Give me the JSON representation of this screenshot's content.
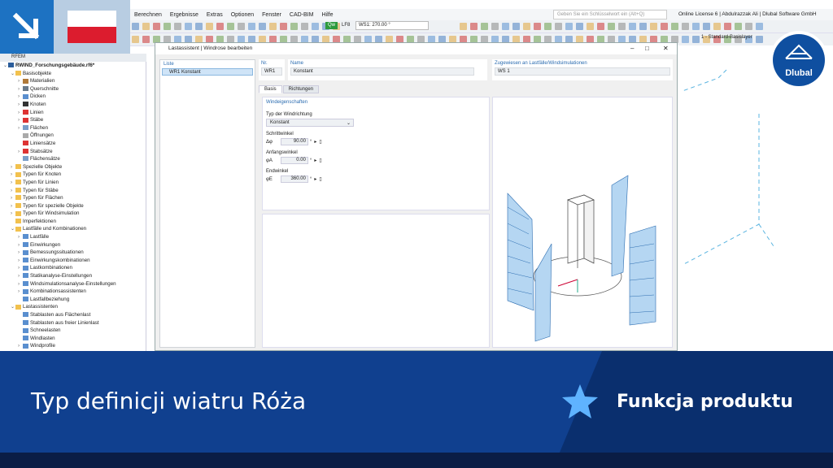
{
  "menu": [
    "Berechnen",
    "Ergebnisse",
    "Extras",
    "Optionen",
    "Fenster",
    "CAD-BIM",
    "Hilfe"
  ],
  "search_placeholder": "Geben Sie ein Schlüsselwort ein (Alt+Q)",
  "license": "Online License 6 | Abdulrazzak Ali | Dlubal Software GmbH",
  "toolbar": {
    "lf_badge": "Qw",
    "lf_num": "LF8",
    "ws": "WS1: 270.00 °",
    "layer": "1 - Standard-Basislayer"
  },
  "navigator": {
    "header": "RFEM",
    "items": [
      {
        "label": "RWIND_Forschungsgebäude.rf6*",
        "level": 0,
        "exp": "⌄",
        "icon": "#2b5d9b"
      },
      {
        "label": "Basisobjekte",
        "level": 1,
        "exp": "⌄",
        "icon": "#f2c14e"
      },
      {
        "label": "Materialien",
        "level": 2,
        "exp": "›",
        "icon": "#b07a3a"
      },
      {
        "label": "Querschnitte",
        "level": 2,
        "exp": "›",
        "icon": "#6a7b8c"
      },
      {
        "label": "Dicken",
        "level": 2,
        "exp": "›",
        "icon": "#5a8fcf"
      },
      {
        "label": "Knoten",
        "level": 2,
        "exp": "›",
        "icon": "#333"
      },
      {
        "label": "Linien",
        "level": 2,
        "exp": "›",
        "icon": "#d33"
      },
      {
        "label": "Stäbe",
        "level": 2,
        "exp": "›",
        "icon": "#d33"
      },
      {
        "label": "Flächen",
        "level": 2,
        "exp": "›",
        "icon": "#7a9ec8"
      },
      {
        "label": "Öffnungen",
        "level": 2,
        "exp": "",
        "icon": "#aaa"
      },
      {
        "label": "Liniensätze",
        "level": 2,
        "exp": "",
        "icon": "#d33"
      },
      {
        "label": "Stabsätze",
        "level": 2,
        "exp": "›",
        "icon": "#d33"
      },
      {
        "label": "Flächensätze",
        "level": 2,
        "exp": "",
        "icon": "#7a9ec8"
      },
      {
        "label": "Spezielle Objekte",
        "level": 1,
        "exp": "›",
        "icon": "#f2c14e"
      },
      {
        "label": "Typen für Knoten",
        "level": 1,
        "exp": "›",
        "icon": "#f2c14e"
      },
      {
        "label": "Typen für Linien",
        "level": 1,
        "exp": "›",
        "icon": "#f2c14e"
      },
      {
        "label": "Typen für Stäbe",
        "level": 1,
        "exp": "›",
        "icon": "#f2c14e"
      },
      {
        "label": "Typen für Flächen",
        "level": 1,
        "exp": "›",
        "icon": "#f2c14e"
      },
      {
        "label": "Typen für spezielle Objekte",
        "level": 1,
        "exp": "›",
        "icon": "#f2c14e"
      },
      {
        "label": "Typen für Windsimulation",
        "level": 1,
        "exp": "›",
        "icon": "#f2c14e"
      },
      {
        "label": "Imperfektionen",
        "level": 1,
        "exp": "",
        "icon": "#f2c14e"
      },
      {
        "label": "Lastfälle und Kombinationen",
        "level": 1,
        "exp": "⌄",
        "icon": "#f2c14e"
      },
      {
        "label": "Lastfälle",
        "level": 2,
        "exp": "›",
        "icon": "#5a8fcf"
      },
      {
        "label": "Einwirkungen",
        "level": 2,
        "exp": "›",
        "icon": "#5a8fcf"
      },
      {
        "label": "Bemessungssituationen",
        "level": 2,
        "exp": "›",
        "icon": "#5a8fcf"
      },
      {
        "label": "Einwirkungskombinationen",
        "level": 2,
        "exp": "›",
        "icon": "#5a8fcf"
      },
      {
        "label": "Lastkombinationen",
        "level": 2,
        "exp": "›",
        "icon": "#5a8fcf"
      },
      {
        "label": "Statikanalyse-Einstellungen",
        "level": 2,
        "exp": "›",
        "icon": "#5a8fcf"
      },
      {
        "label": "Windsimulationsanalyse-Einstellungen",
        "level": 2,
        "exp": "›",
        "icon": "#5a8fcf"
      },
      {
        "label": "Kombinationsassistenten",
        "level": 2,
        "exp": "›",
        "icon": "#5a8fcf"
      },
      {
        "label": "Lastfallbeziehung",
        "level": 2,
        "exp": "",
        "icon": "#5a8fcf"
      },
      {
        "label": "Lastassistenten",
        "level": 1,
        "exp": "⌄",
        "icon": "#f2c14e"
      },
      {
        "label": "Stablasten aus Flächenlast",
        "level": 2,
        "exp": "",
        "icon": "#5a8fcf"
      },
      {
        "label": "Stablasten aus freier Linienlast",
        "level": 2,
        "exp": "",
        "icon": "#5a8fcf"
      },
      {
        "label": "Schneelasten",
        "level": 2,
        "exp": "",
        "icon": "#5a8fcf"
      },
      {
        "label": "Windlasten",
        "level": 2,
        "exp": "",
        "icon": "#5a8fcf"
      },
      {
        "label": "Windprofile",
        "level": 2,
        "exp": "›",
        "icon": "#5a8fcf"
      }
    ]
  },
  "dialog": {
    "title": "Lastassistent | Windrose bearbeiten",
    "list_header": "Liste",
    "list_item": "WR1  Konstant",
    "nr_label": "Nr.",
    "nr_value": "WR1",
    "name_label": "Name",
    "name_value": "Konstant",
    "assigned_label": "Zugewiesen an Lastfälle/Windsimulationen",
    "assigned_value": "WS 1",
    "tabs": [
      "Basis",
      "Richtungen"
    ],
    "section": "Windeigenschaften",
    "type_label": "Typ der Windrichtung",
    "type_value": "Konstant",
    "step_label": "Schrittwinkel",
    "step_sym": "Δφ",
    "step_value": "90.00",
    "start_label": "Anfangswinkel",
    "start_sym": "φA",
    "start_value": "0.00",
    "end_label": "Endwinkel",
    "end_sym": "φE",
    "end_value": "360.00",
    "unit": "°"
  },
  "banner": {
    "title": "Typ definicji wiatru Róża",
    "feature": "Funkcja produktu"
  },
  "logo": "Dlubal",
  "colors": {
    "brand_blue": "#1d72c2",
    "banner": "#10408f",
    "accent": "#2b6cb0"
  }
}
